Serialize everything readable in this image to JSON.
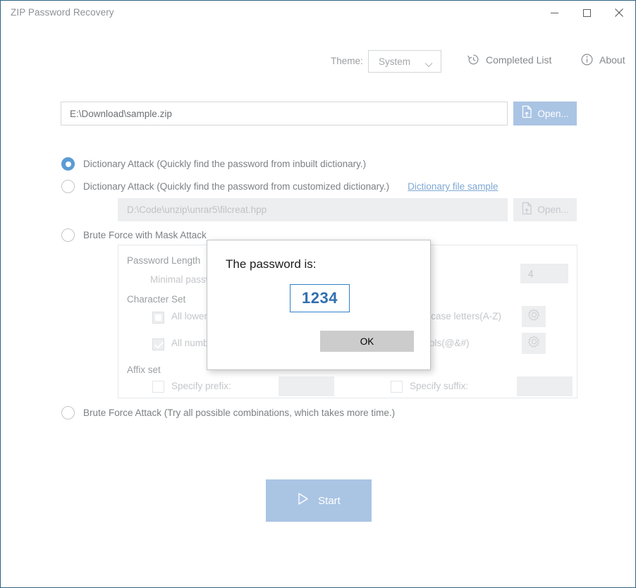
{
  "window": {
    "title": "ZIP Password Recovery",
    "controls": {
      "minimize": "minimize-icon",
      "maximize": "maximize-icon",
      "close": "close-icon"
    },
    "border_color": "#2e6384"
  },
  "header": {
    "theme_label": "Theme:",
    "theme_value": "System",
    "theme_options": [
      "System"
    ],
    "completed_list": "Completed List",
    "about": "About",
    "icons": {
      "history": "history-icon",
      "info": "info-icon",
      "chevron": "chevron-down-icon"
    }
  },
  "file": {
    "path": "E:\\Download\\sample.zip",
    "open_label": "Open...",
    "open_icon": "file-open-icon"
  },
  "dictionary_file": {
    "path": "D:\\Code\\unzip\\unrar5\\filcreat.hpp",
    "open_label": "Open...",
    "open_icon": "file-open-icon"
  },
  "attacks": [
    {
      "id": "dictionary-inbuilt",
      "label": "Dictionary Attack (Quickly find the password from inbuilt dictionary.)",
      "selected": true
    },
    {
      "id": "dictionary-custom",
      "label": "Dictionary Attack (Quickly find the password from customized dictionary.)",
      "selected": false,
      "link": "Dictionary file sample"
    },
    {
      "id": "brute-force-mask",
      "label": "Brute Force with Mask Attack",
      "selected": false
    },
    {
      "id": "brute-force",
      "label": "Brute Force Attack (Try all possible combinations, which takes more time.)",
      "selected": false
    }
  ],
  "mask_panel": {
    "password_length_title": "Password Length",
    "minimal_length_label": "Minimal password length",
    "minimal_length_value": "4",
    "character_set_title": "Character Set",
    "charset_rows": [
      {
        "left_label": "All lowercase letters(a-z)",
        "left_state": "square",
        "right_label": "All uppercase letters(A-Z)",
        "gear": "gear-icon"
      },
      {
        "left_label": "All numbers(0-9)",
        "left_state": "check",
        "right_label": "All symbols(@&#)",
        "gear": "gear-icon"
      }
    ],
    "affix_title": "Affix set",
    "prefix_label": "Specify prefix:",
    "prefix_value": "",
    "suffix_label": "Specify suffix:",
    "suffix_value": ""
  },
  "start": {
    "label": "Start",
    "icon": "play-icon"
  },
  "dialog": {
    "title": "The password is:",
    "password": "1234",
    "ok_label": "OK",
    "password_color": "#2f6fae",
    "password_border_color": "#2f80c9"
  }
}
